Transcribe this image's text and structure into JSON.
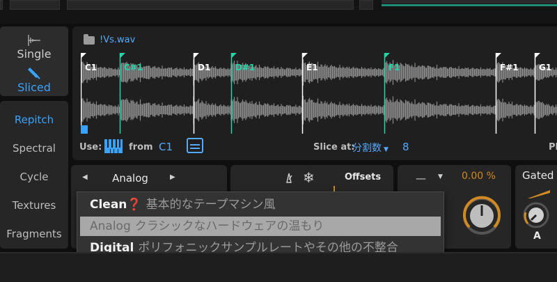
{
  "modes": {
    "single": "Single",
    "sliced": "Sliced"
  },
  "algorithms": [
    "Repitch",
    "Spectral",
    "Cycle",
    "Textures",
    "Fragments"
  ],
  "sample": {
    "filename": "!Vs.wav",
    "slices": [
      {
        "label": "C1",
        "color": "#ffffff"
      },
      {
        "label": "C#1",
        "color": "#22d6a8"
      },
      {
        "label": "D1",
        "color": "#ffffff"
      },
      {
        "label": "D#1",
        "color": "#22d6a8"
      },
      {
        "label": "E1",
        "color": "#ffffff"
      },
      {
        "label": "F1",
        "color": "#22d6a8"
      },
      {
        "label": "F#1",
        "color": "#ffffff"
      },
      {
        "label": "G1",
        "color": "#ffffff"
      }
    ],
    "use_label": "Use:",
    "from_label": "from",
    "from_value": "C1",
    "slice_at_label": "Slice at:",
    "slice_at_value": "分割数",
    "slice_count": "8",
    "cut_label": "Pl"
  },
  "algo_panel": {
    "selected": "Analog"
  },
  "mid_panel": {
    "offsets_label": "Offsets"
  },
  "right_panel": {
    "dash": "—",
    "percent": "0.00 %"
  },
  "gate_panel": {
    "gated_label": "Gated",
    "a_label": "A"
  },
  "popup": {
    "options": [
      {
        "name": "Clean❓",
        "desc": "基本的なテープマシン風"
      },
      {
        "name": "Analog",
        "desc": "クラシックなハードウェアの温もり"
      },
      {
        "name": "Digital",
        "desc": "ポリフォニックサンプルレートやその他の不整合"
      }
    ]
  },
  "colors": {
    "accent_blue": "#3aa3ff",
    "slice_green": "#22d6a8",
    "orange": "#d08a20"
  }
}
